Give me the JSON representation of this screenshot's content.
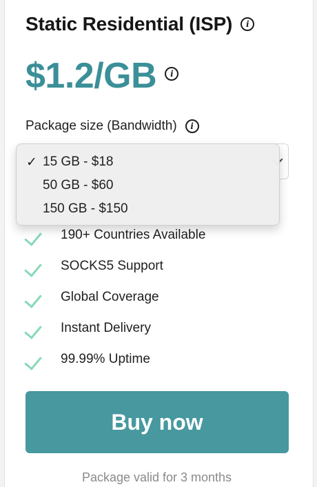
{
  "card": {
    "title": "Static Residential (ISP)",
    "price": "$1.2/GB",
    "package_label": "Package size (Bandwidth)",
    "select": {
      "selected_value": "15 GB - $18",
      "options": [
        "15 GB - $18",
        "50 GB - $60",
        "150 GB - $150"
      ]
    },
    "features": [
      "190+ Countries Available",
      "SOCKS5 Support",
      "Global Coverage",
      "Instant Delivery",
      "99.99% Uptime"
    ],
    "buy_label": "Buy now",
    "validity": "Package valid for 3 months",
    "colors": {
      "price": "#3b8f98",
      "button": "#47989f",
      "check": "#86d9b7"
    },
    "icons": {
      "info": "info-icon",
      "check": "check-icon",
      "chevron": "chevron-down-icon"
    }
  }
}
